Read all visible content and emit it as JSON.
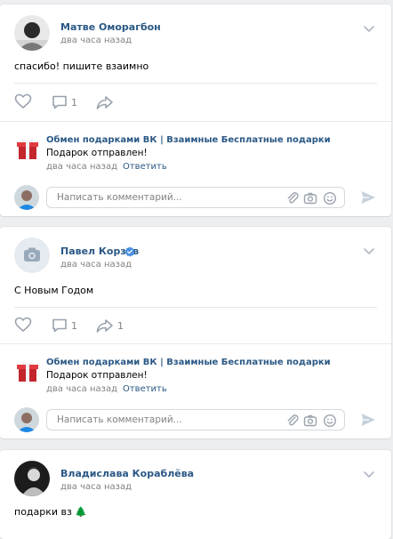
{
  "posts": [
    {
      "author": "Матве Оморагбон",
      "time": "два часа назад",
      "text": "спасибо! пишите взаимно",
      "comments_count": "1",
      "shares_count": "",
      "comment": {
        "author": "Обмен подарками ВК | Взаимные Бесплатные подарки",
        "text": "Подарок отправлен!",
        "time": "два часа назад",
        "reply": "Ответить"
      }
    },
    {
      "author": "Павел Корзов",
      "time": "два часа назад",
      "text": "С Новым Годом",
      "comments_count": "1",
      "shares_count": "1",
      "comment": {
        "author": "Обмен подарками ВК | Взаимные Бесплатные подарки",
        "text": "Подарок отправлен!",
        "time": "два часа назад",
        "reply": "Ответить"
      }
    },
    {
      "author": "Владислава Кораблёва",
      "time": "два часа назад",
      "text": "подарки вз 🌲"
    }
  ],
  "comment_input": {
    "placeholder": "Написать комментарий..."
  },
  "colors": {
    "link": "#2a5885",
    "muted": "#828282",
    "icon": "#99a2ad",
    "background": "#edeef0",
    "verified": "#4a90e2"
  },
  "icons": [
    "chevron-down-icon",
    "like-icon",
    "comment-icon",
    "share-icon",
    "attach-icon",
    "camera-icon",
    "emoji-icon",
    "send-icon",
    "verified-icon",
    "gift-icon"
  ]
}
